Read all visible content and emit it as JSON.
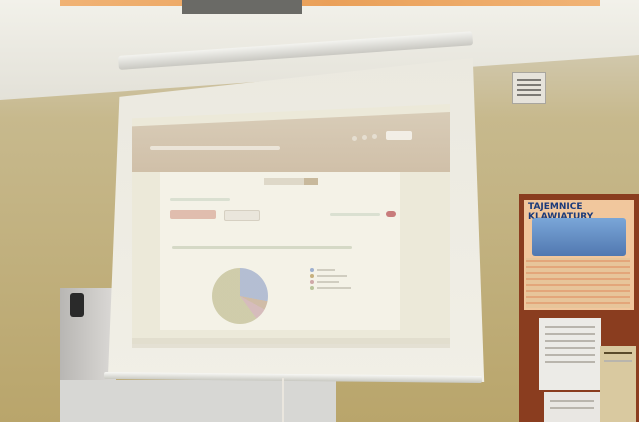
{
  "scene": {
    "description_type": "photo",
    "poster": {
      "title": "TAJEMNICE KLAWIATURY"
    },
    "colors": {
      "wall": "#c7b98d",
      "screen": "#efede4",
      "poster": "#f1c79d",
      "corkboard": "#8a3d1f",
      "poster_title": "#1a3a7a"
    }
  }
}
